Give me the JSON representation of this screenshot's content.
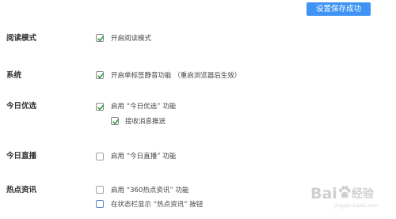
{
  "header": {
    "save_status": "设置保存成功"
  },
  "sections": {
    "reading_mode": {
      "label": "阅读模式",
      "options": [
        {
          "text": "开启阅读模式",
          "checked": true
        }
      ]
    },
    "system": {
      "label": "系统",
      "options": [
        {
          "text": "开启单标签静音功能  （重启浏览器后生效）",
          "checked": true
        }
      ]
    },
    "today_picks": {
      "label": "今日优选",
      "options": [
        {
          "text": "启用 “今日优选” 功能",
          "checked": true
        },
        {
          "text": "接收消息推送",
          "checked": true
        }
      ]
    },
    "today_live": {
      "label": "今日直播",
      "options": [
        {
          "text": "启用 “今日直播” 功能",
          "checked": false
        }
      ]
    },
    "hot_news": {
      "label": "热点资讯",
      "options": [
        {
          "text": "启用 “360热点资讯” 功能",
          "checked": false
        },
        {
          "text": "在状态栏显示 “热点资讯” 按钮",
          "checked": false
        }
      ]
    }
  },
  "watermark": {
    "brand_left": "Bai",
    "brand_right": "经验",
    "url": "jingyan.baidu.com"
  },
  "colors": {
    "accent": "#3e93f3",
    "check": "#2c9a3b"
  }
}
